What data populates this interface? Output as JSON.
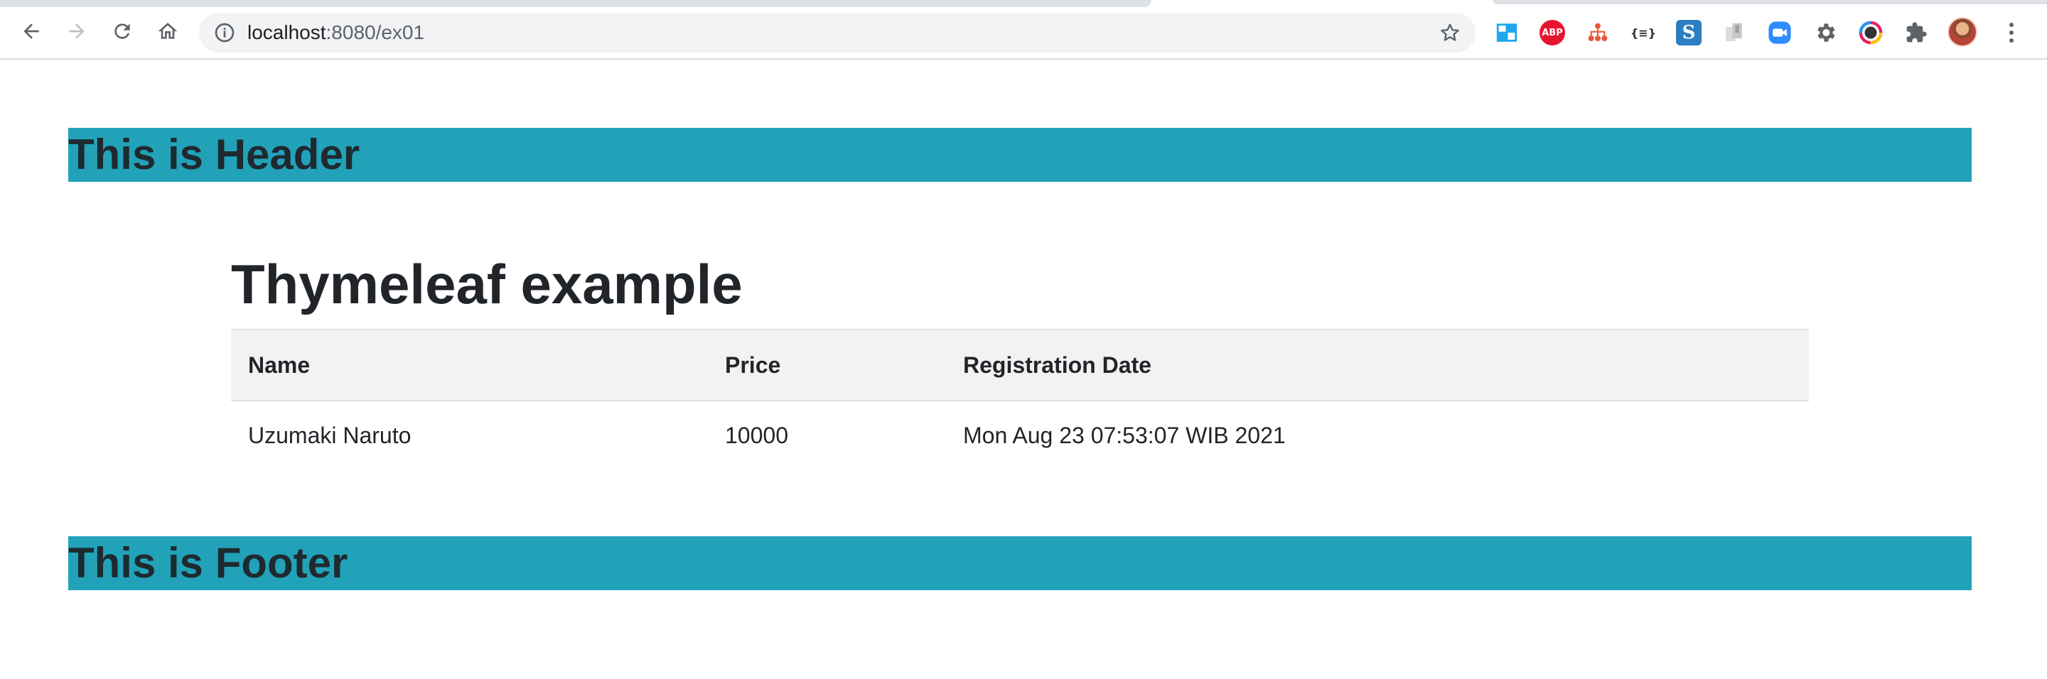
{
  "browser": {
    "url_host": "localhost",
    "url_path": ":8080/ex01",
    "extensions": [
      {
        "name": "tab-resize-extension-icon",
        "label": "",
        "color": "#1ea7f0"
      },
      {
        "name": "adblock-plus-icon",
        "label": "ABP",
        "color": "#e8132e"
      },
      {
        "name": "sitemap-extension-icon",
        "label": "",
        "color": "#e5583b"
      },
      {
        "name": "json-formatter-icon",
        "label": "{≡}",
        "color": "#333333"
      },
      {
        "name": "s-extension-icon",
        "label": "S",
        "color": "#2b7ec1"
      },
      {
        "name": "disabled-extension-icon",
        "label": "",
        "color": "#c8c8c8"
      },
      {
        "name": "zoom-extension-icon",
        "label": "",
        "color": "#2d8cff"
      },
      {
        "name": "gear-extension-icon",
        "label": "",
        "color": "#5f6368"
      },
      {
        "name": "color-picker-extension-icon",
        "label": "",
        "color": "#e91e63"
      },
      {
        "name": "extensions-puzzle-icon",
        "label": "",
        "color": "#5f6368"
      }
    ]
  },
  "header": {
    "text": "This is Header"
  },
  "main": {
    "title": "Thymeleaf example",
    "table": {
      "columns": [
        "Name",
        "Price",
        "Registration Date"
      ],
      "rows": [
        [
          "Uzumaki Naruto",
          "10000",
          "Mon Aug 23 07:53:07 WIB 2021"
        ]
      ]
    }
  },
  "footer": {
    "text": "This is Footer"
  },
  "colors": {
    "banner": "#22a2b8",
    "table_header_bg": "#f2f2f2"
  }
}
